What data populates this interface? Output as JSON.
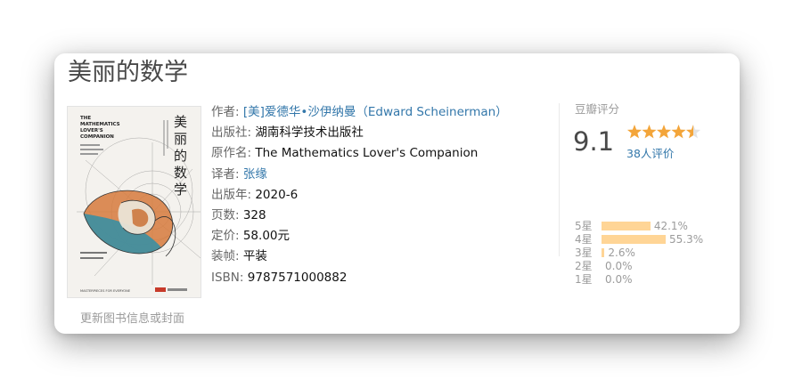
{
  "book": {
    "title": "美丽的数学",
    "update_link": "更新图书信息或封面",
    "cover": {
      "en_title": [
        "THE",
        "MATHEMATICS",
        "LOVER'S",
        "COMPANION"
      ],
      "cn_title": [
        "美",
        "丽",
        "的",
        "数",
        "学"
      ],
      "series": "MASTERPIECES FOR EVERYONE"
    }
  },
  "info": [
    {
      "key": "作者: ",
      "value": "[美]爱德华•沙伊纳曼（Edward Scheinerman）",
      "link": true
    },
    {
      "key": "出版社: ",
      "value": "湖南科学技术出版社",
      "link": false
    },
    {
      "key": "原作名: ",
      "value": "The Mathematics Lover's Companion",
      "link": false
    },
    {
      "key": "译者: ",
      "value": "张缘",
      "link": true
    },
    {
      "key": "出版年: ",
      "value": "2020-6",
      "link": false
    },
    {
      "key": "页数: ",
      "value": "328",
      "link": false
    },
    {
      "key": "定价: ",
      "value": "58.00元",
      "link": false
    },
    {
      "key": "装帧: ",
      "value": "平装",
      "link": false
    },
    {
      "key": "ISBN: ",
      "value": "9787571000882",
      "link": false
    }
  ],
  "rating": {
    "label": "豆瓣评分",
    "score": "9.1",
    "stars_value": 4.5,
    "count": "38人评价",
    "star_color": "#f3a53a",
    "star_empty_color": "#e3e3e3",
    "bar_color": "#ffd596",
    "breakdown": [
      {
        "level": "5星",
        "percent": "42.1%",
        "value": 42.1
      },
      {
        "level": "4星",
        "percent": "55.3%",
        "value": 55.3
      },
      {
        "level": "3星",
        "percent": "2.6%",
        "value": 2.6
      },
      {
        "level": "2星",
        "percent": "0.0%",
        "value": 0
      },
      {
        "level": "1星",
        "percent": "0.0%",
        "value": 0
      }
    ]
  }
}
